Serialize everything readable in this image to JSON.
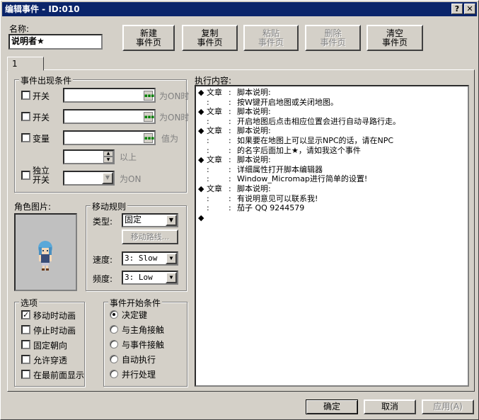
{
  "window": {
    "title": "编辑事件 - ID:010",
    "help": "?",
    "close": "✕"
  },
  "name": {
    "label": "名称:",
    "value": "说明者★"
  },
  "page_buttons": [
    {
      "line1": "新建",
      "line2": "事件页",
      "enabled": true
    },
    {
      "line1": "复制",
      "line2": "事件页",
      "enabled": true
    },
    {
      "line1": "粘贴",
      "line2": "事件页",
      "enabled": false
    },
    {
      "line1": "删除",
      "line2": "事件页",
      "enabled": false
    },
    {
      "line1": "清空",
      "line2": "事件页",
      "enabled": true
    }
  ],
  "tab": "1",
  "conditions": {
    "title": "事件出现条件",
    "switch1": {
      "label": "开关",
      "suffix": "为ON时"
    },
    "switch2": {
      "label": "开关",
      "suffix": "为ON时"
    },
    "variable": {
      "label": "变量",
      "suffix": "值为",
      "above": "以上"
    },
    "self_switch": {
      "label1": "独立",
      "label2": "开关",
      "suffix": "为ON"
    }
  },
  "graphic": {
    "label": "角色图片:"
  },
  "movement": {
    "title": "移动规则",
    "type_label": "类型:",
    "type_value": "固定",
    "route_button": "移动路线...",
    "speed_label": "速度:",
    "speed_value": "3: Slow",
    "freq_label": "频度:",
    "freq_value": "3: Low"
  },
  "options": {
    "title": "选项",
    "items": [
      {
        "label": "移动时动画",
        "checked": true
      },
      {
        "label": "停止时动画",
        "checked": false
      },
      {
        "label": "固定朝向",
        "checked": false
      },
      {
        "label": "允许穿透",
        "checked": false
      },
      {
        "label": "在最前面显示",
        "checked": false
      }
    ]
  },
  "trigger": {
    "title": "事件开始条件",
    "items": [
      {
        "label": "决定键",
        "selected": true
      },
      {
        "label": "与主角接触",
        "selected": false
      },
      {
        "label": "与事件接触",
        "selected": false
      },
      {
        "label": "自动执行",
        "selected": false
      },
      {
        "label": "并行处理",
        "selected": false
      }
    ]
  },
  "execution": {
    "label": "执行内容:",
    "lines": [
      {
        "lead": "◆",
        "cmd": "文章",
        "sep": ":",
        "text": "脚本说明:"
      },
      {
        "lead": ":",
        "cmd": "",
        "sep": ":",
        "text": "按W键开启地图或关闭地图。"
      },
      {
        "lead": "◆",
        "cmd": "文章",
        "sep": ":",
        "text": "脚本说明:"
      },
      {
        "lead": ":",
        "cmd": "",
        "sep": ":",
        "text": "开启地图后点击相应位置会进行自动寻路行走。"
      },
      {
        "lead": "◆",
        "cmd": "文章",
        "sep": ":",
        "text": "脚本说明:"
      },
      {
        "lead": ":",
        "cmd": "",
        "sep": ":",
        "text": "如果要在地图上可以显示NPC的话，请在NPC"
      },
      {
        "lead": ":",
        "cmd": "",
        "sep": ":",
        "text": "的名字后面加上★，请如我这个事件"
      },
      {
        "lead": "◆",
        "cmd": "文章",
        "sep": ":",
        "text": "脚本说明:"
      },
      {
        "lead": ":",
        "cmd": "",
        "sep": ":",
        "text": "详细属性打开脚本编辑器"
      },
      {
        "lead": ":",
        "cmd": "",
        "sep": ":",
        "text": "Window_Micromap进行简单的设置!"
      },
      {
        "lead": "◆",
        "cmd": "文章",
        "sep": ":",
        "text": "脚本说明:"
      },
      {
        "lead": ":",
        "cmd": "",
        "sep": ":",
        "text": "有说明意见可以联系我!"
      },
      {
        "lead": ":",
        "cmd": "",
        "sep": ":",
        "text": "茄子 QQ 9244579"
      },
      {
        "lead": "◆",
        "cmd": "",
        "sep": "",
        "text": ""
      }
    ]
  },
  "footer": {
    "ok": "确定",
    "cancel": "取消",
    "apply": "应用(A)"
  }
}
